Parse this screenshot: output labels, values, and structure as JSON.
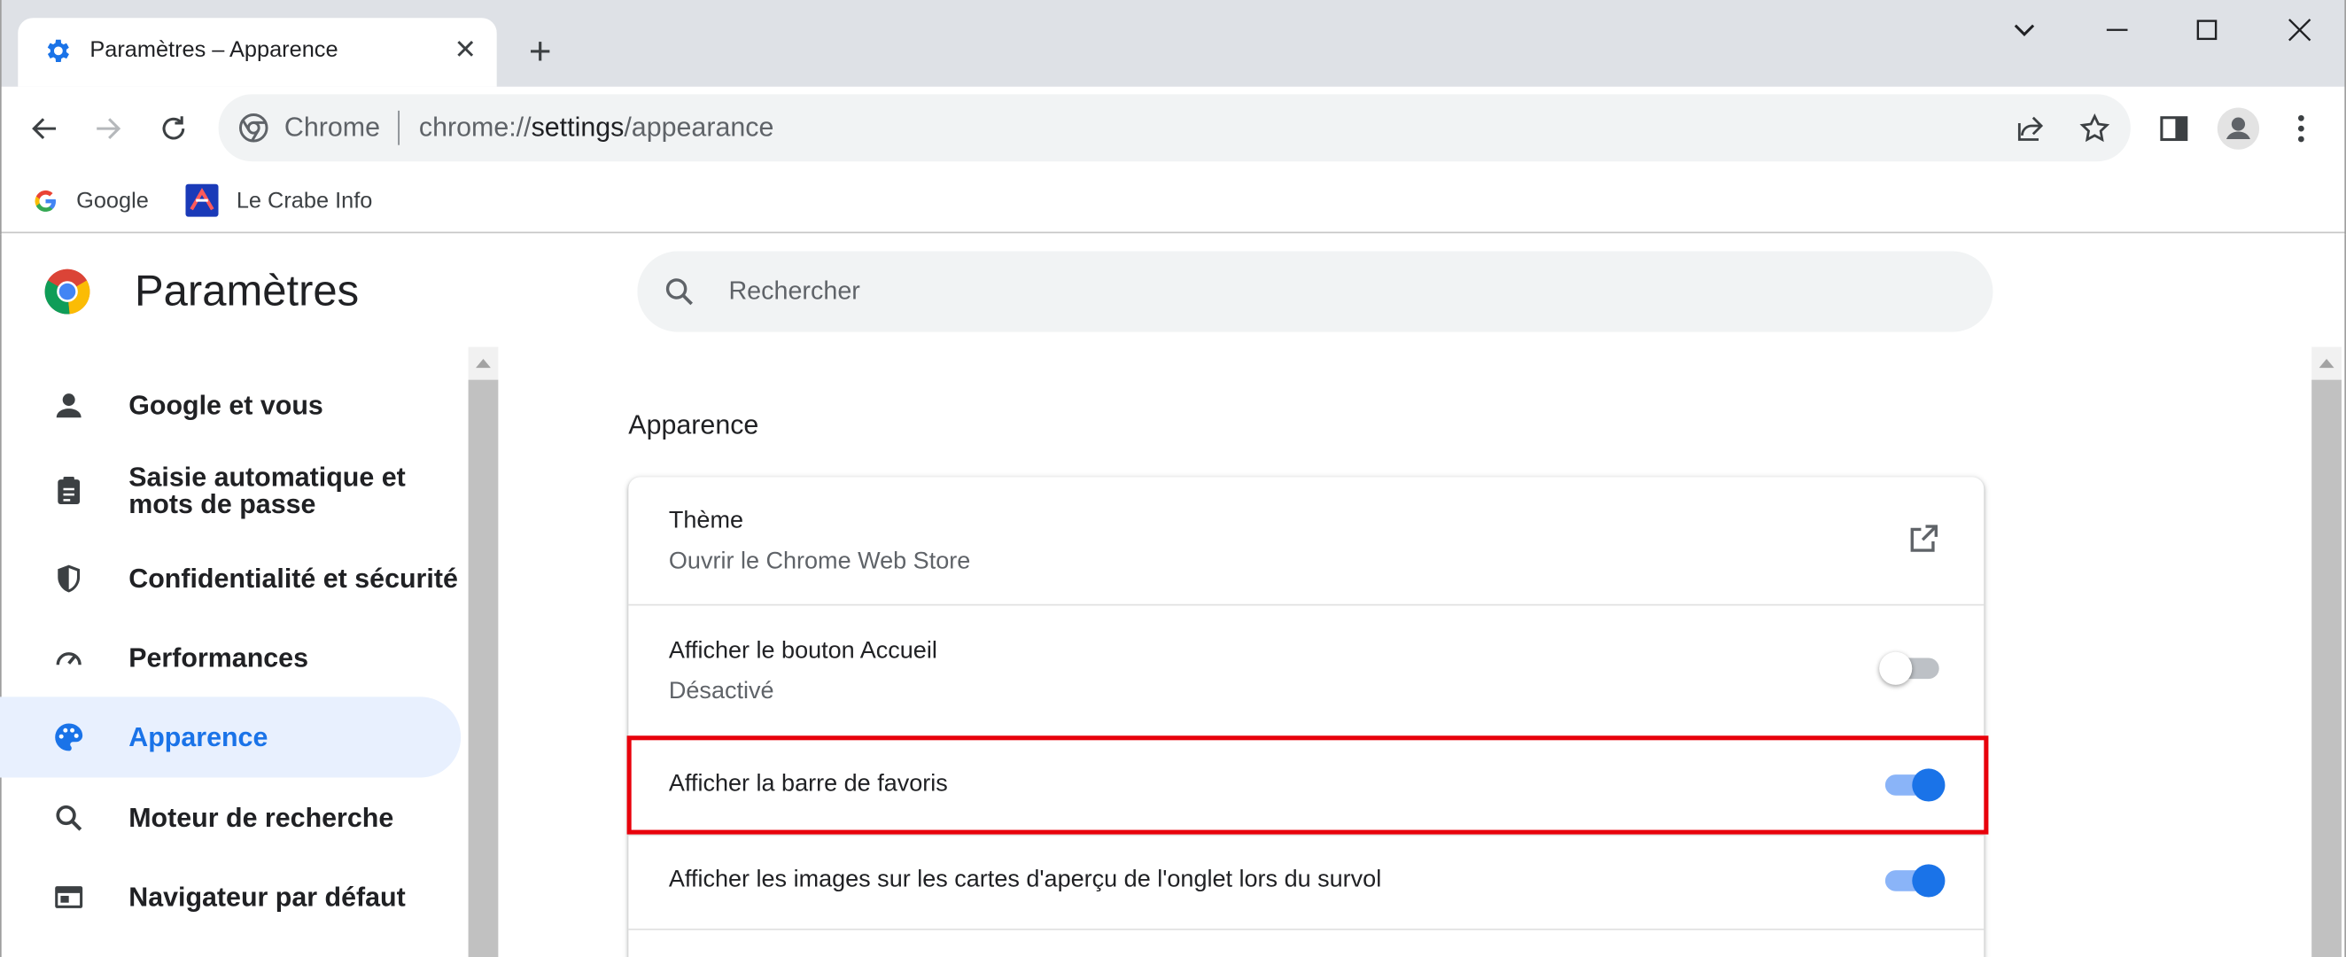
{
  "browser": {
    "tab": {
      "title": "Paramètres – Apparence",
      "close": "✕"
    },
    "new_tab": "+",
    "omnibox": {
      "chip": "Chrome",
      "url_scheme": "chrome://",
      "url_host": "settings",
      "url_path": "/appearance"
    },
    "bookmarks": [
      {
        "label": "Google",
        "icon": "google-g-icon"
      },
      {
        "label": "Le Crabe Info",
        "icon": "le-crabe-info-icon"
      }
    ]
  },
  "settings": {
    "title": "Paramètres",
    "search_placeholder": "Rechercher",
    "sidebar": [
      {
        "label": "Google et vous",
        "icon": "person-icon",
        "active": false
      },
      {
        "label": "Saisie automatique et",
        "label2": "mots de passe",
        "icon": "clipboard-icon",
        "active": false
      },
      {
        "label": "Confidentialité et sécurité",
        "icon": "shield-icon",
        "active": false
      },
      {
        "label": "Performances",
        "icon": "speedometer-icon",
        "active": false
      },
      {
        "label": "Apparence",
        "icon": "palette-icon",
        "active": true
      },
      {
        "label": "Moteur de recherche",
        "icon": "search-icon",
        "active": false
      },
      {
        "label": "Navigateur par défaut",
        "icon": "browser-window-icon",
        "active": false
      }
    ],
    "section_title": "Apparence",
    "rows": [
      {
        "label": "Thème",
        "sub": "Ouvrir le Chrome Web Store",
        "control": "external-link"
      },
      {
        "label": "Afficher le bouton Accueil",
        "sub": "Désactivé",
        "control": "toggle",
        "on": false
      },
      {
        "label": "Afficher la barre de favoris",
        "control": "toggle",
        "on": true,
        "highlighted": true
      },
      {
        "label": "Afficher les images sur les cartes d'aperçu de l'onglet lors du survol",
        "control": "toggle",
        "on": true
      }
    ]
  },
  "colors": {
    "accent": "#1a73e8",
    "highlight_border": "#e8000b",
    "active_nav_bg": "#e8f0fe"
  }
}
